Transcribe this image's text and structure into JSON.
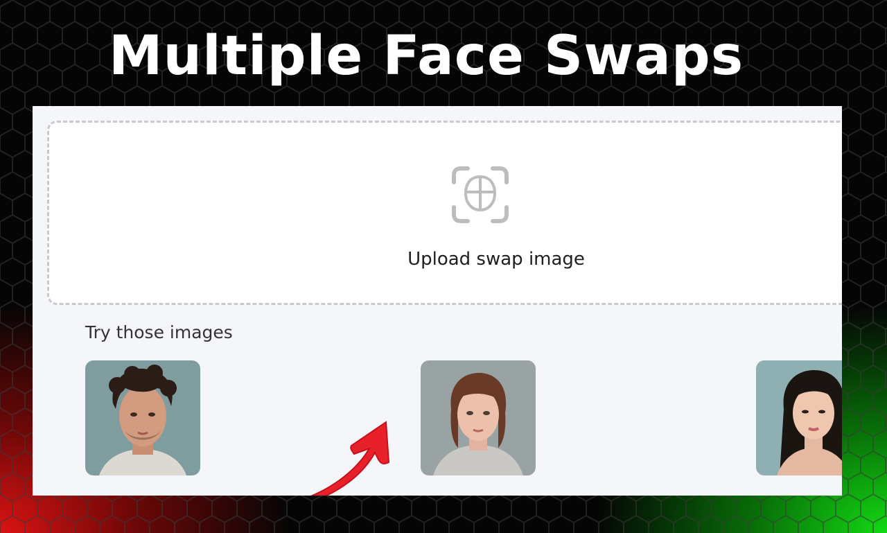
{
  "headline": "Multiple Face Swaps",
  "upload": {
    "label": "Upload swap image",
    "icon": "face-scan-icon"
  },
  "samples": {
    "heading": "Try those images",
    "items": [
      {
        "name": "sample-man-curly-hair"
      },
      {
        "name": "sample-woman-auburn-hair"
      },
      {
        "name": "sample-woman-dark-hair"
      }
    ]
  },
  "colors": {
    "accent_arrow": "#e8202a",
    "panel_bg": "#f4f6fa",
    "dropzone_border": "#c8c9cc",
    "glow_left": "#e61414",
    "glow_right": "#14e614"
  }
}
